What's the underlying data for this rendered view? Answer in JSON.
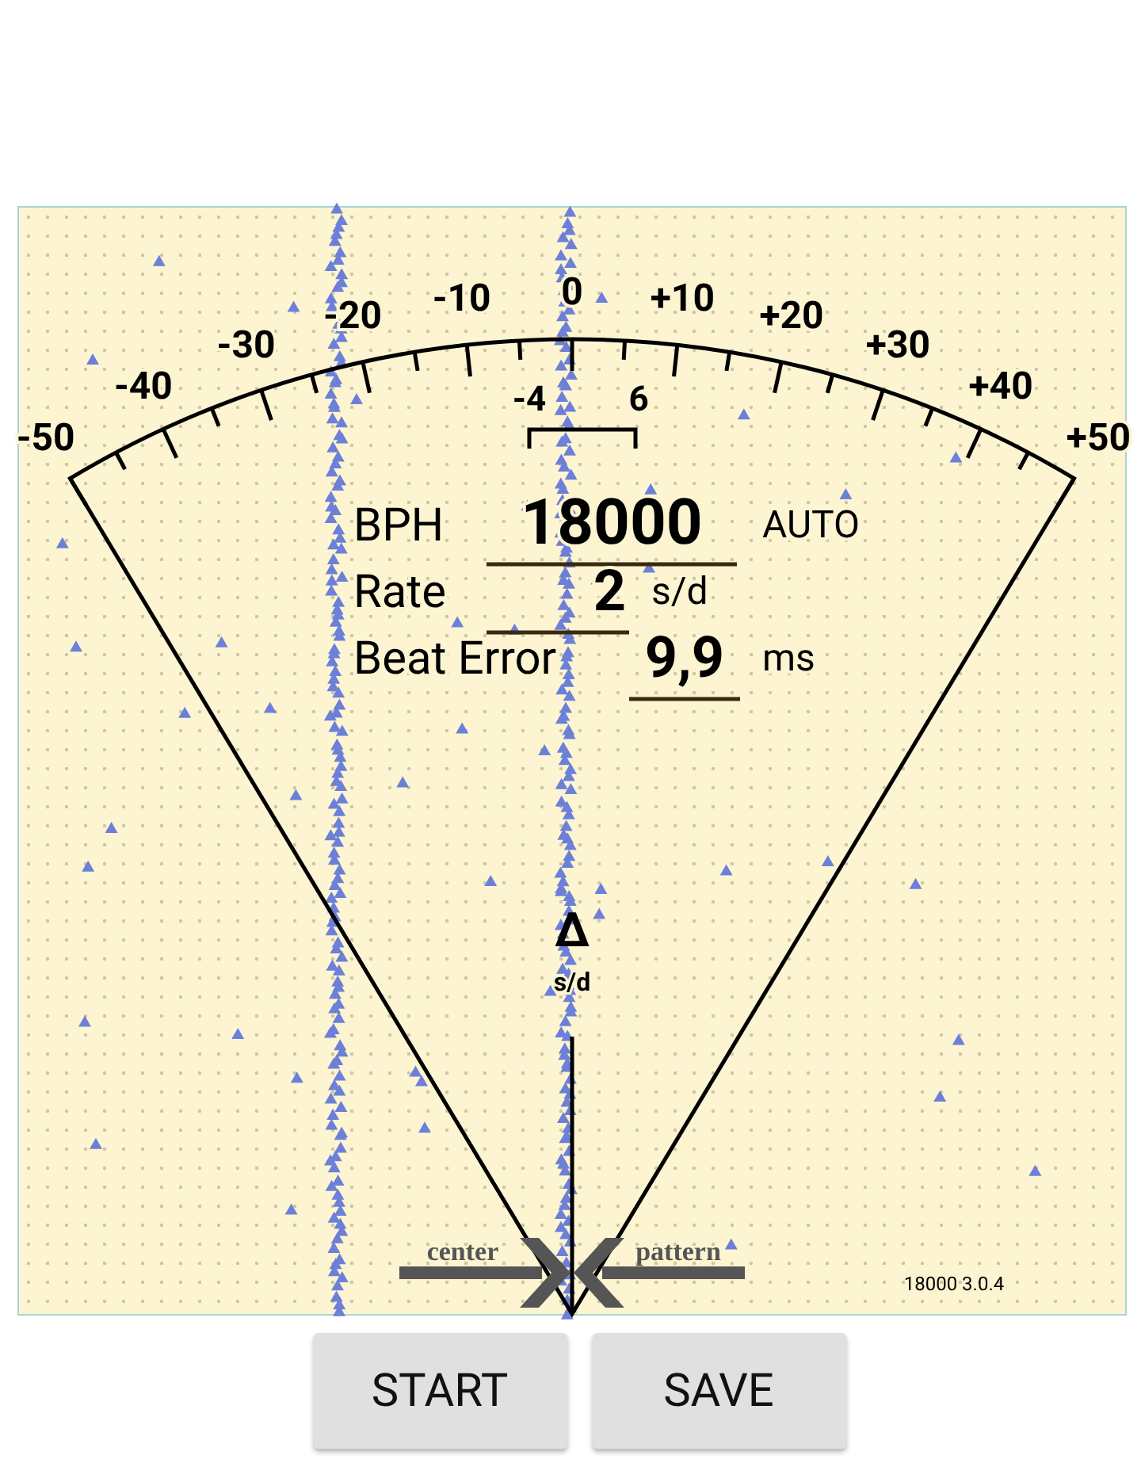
{
  "scale": {
    "labels": [
      "-50",
      "-40",
      "-30",
      "-20",
      "-10",
      "0",
      "+10",
      "+20",
      "+30",
      "+40",
      "+50"
    ],
    "bracket": [
      "-4",
      "6"
    ]
  },
  "readings": [
    {
      "label": "BPH",
      "value": "18000",
      "unit": "AUTO"
    },
    {
      "label": "Rate",
      "value": "2",
      "unit": "s/d"
    },
    {
      "label": "Beat Error",
      "value": "9,9",
      "unit": "ms"
    }
  ],
  "center_marker": {
    "symbol": "Δ",
    "unit": "s/d"
  },
  "alignment": {
    "left": "center",
    "right": "pattern"
  },
  "version": "18000 3.0.4",
  "buttons": [
    "START",
    "SAVE"
  ]
}
